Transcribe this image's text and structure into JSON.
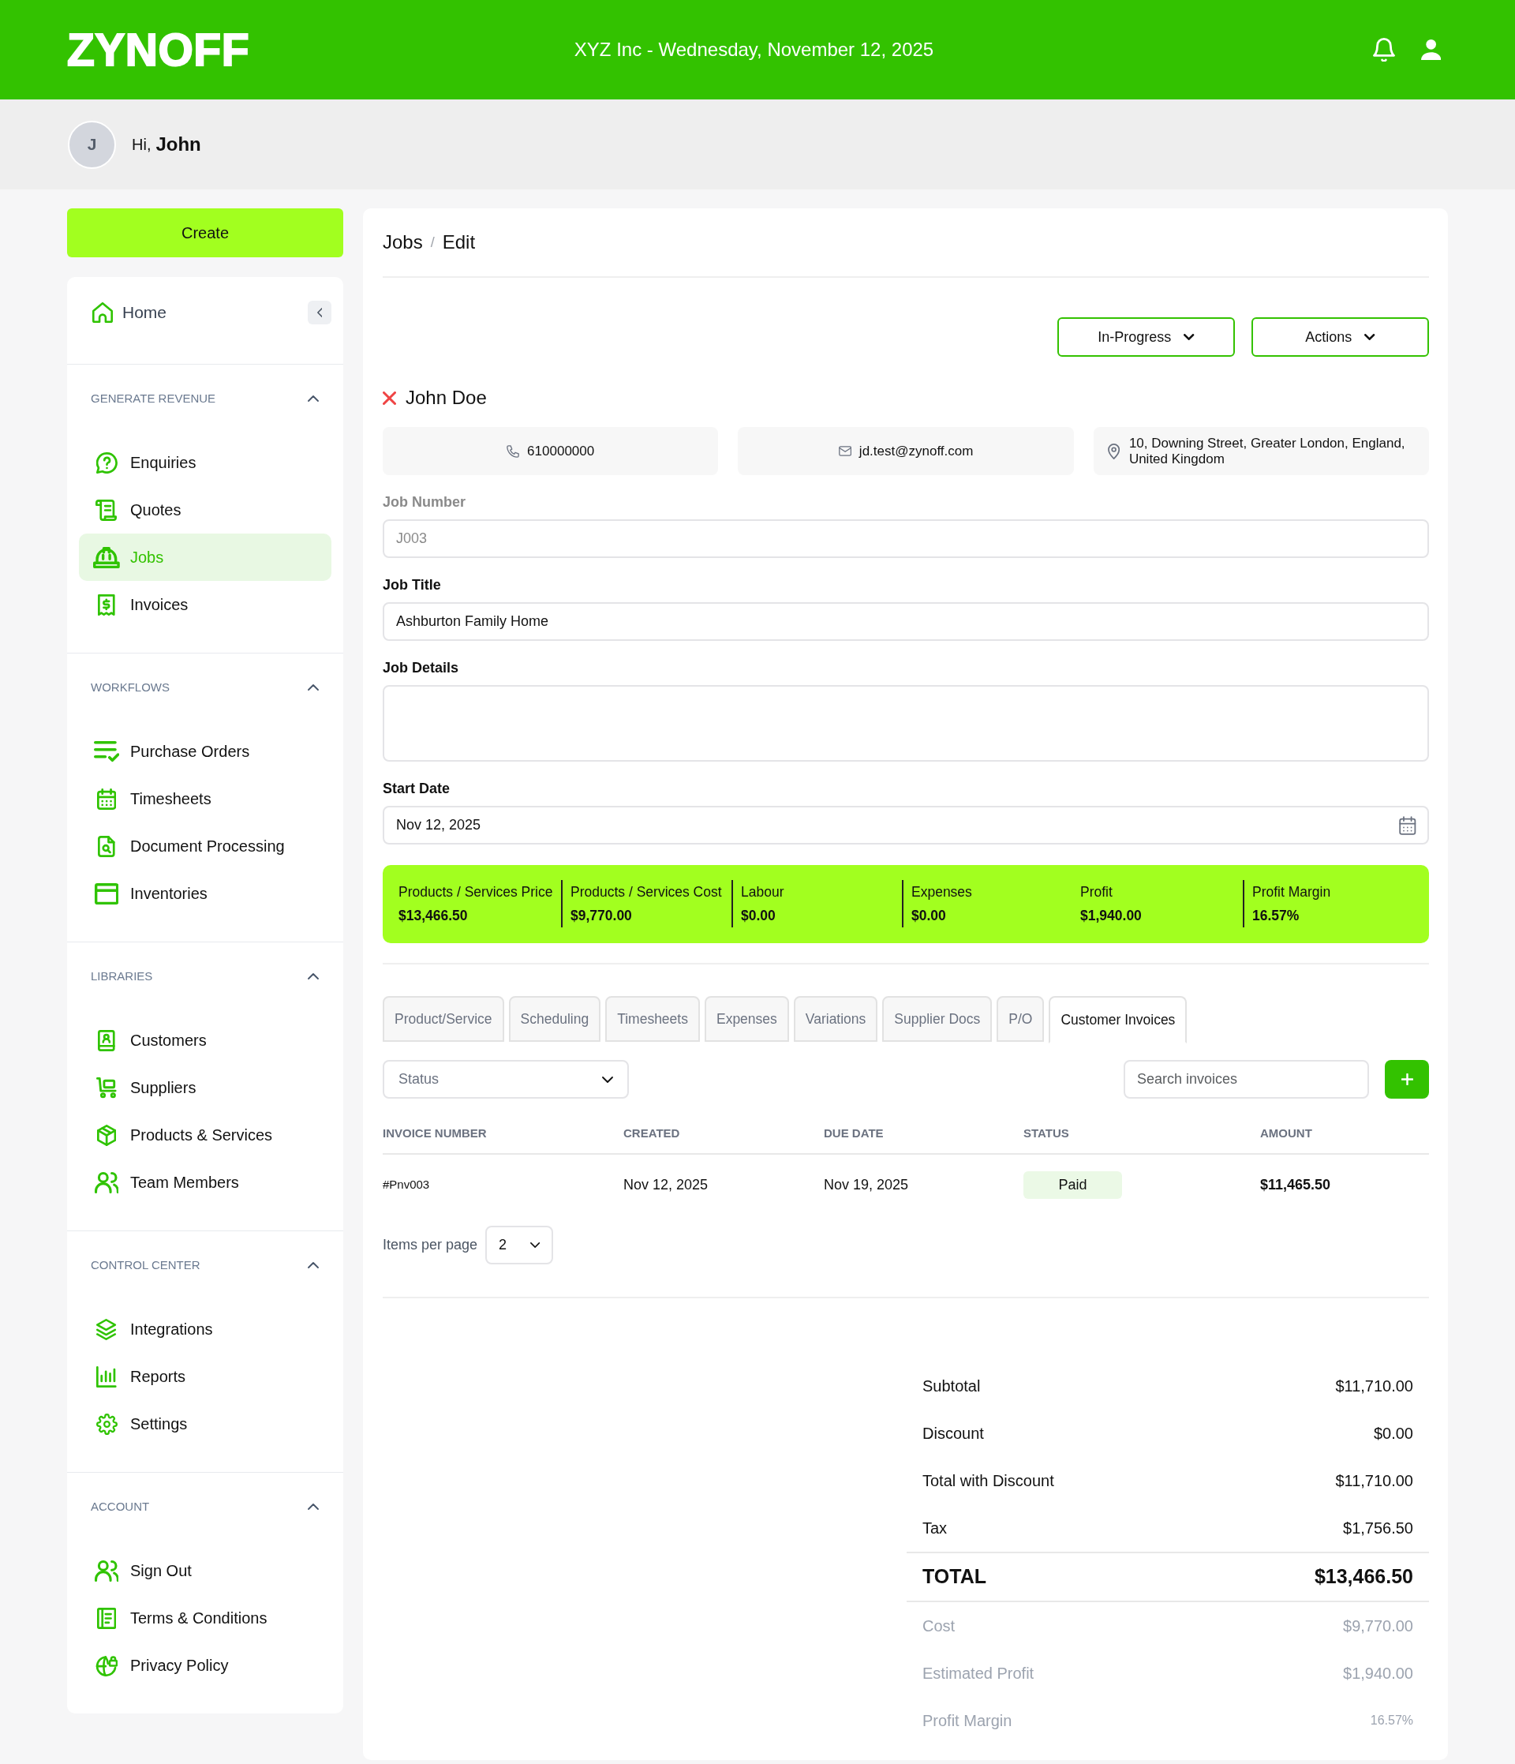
{
  "header": {
    "logo": "ZYNOFF",
    "title": "XYZ Inc - Wednesday, November 12, 2025"
  },
  "greeting": {
    "avatar_initial": "J",
    "salutation": "Hi,",
    "name": "John"
  },
  "sidebar": {
    "create_button": "Create",
    "home": {
      "label": "Home",
      "selected": false
    },
    "sections": [
      {
        "title": "GENERATE REVENUE",
        "expanded": true,
        "items": [
          {
            "label": "Enquiries",
            "selected": false
          },
          {
            "label": "Quotes",
            "selected": false
          },
          {
            "label": "Jobs",
            "selected": true
          },
          {
            "label": "Invoices",
            "selected": false
          }
        ]
      },
      {
        "title": "WORKFLOWS",
        "expanded": true,
        "items": [
          {
            "label": "Purchase Orders",
            "selected": false
          },
          {
            "label": "Timesheets",
            "selected": false
          },
          {
            "label": "Document Processing",
            "selected": false
          },
          {
            "label": "Inventories",
            "selected": false
          }
        ]
      },
      {
        "title": "LIBRARIES",
        "expanded": true,
        "items": [
          {
            "label": "Customers",
            "selected": false
          },
          {
            "label": "Suppliers",
            "selected": false
          },
          {
            "label": "Products & Services",
            "selected": false
          },
          {
            "label": "Team Members",
            "selected": false
          }
        ]
      },
      {
        "title": "CONTROL CENTER",
        "expanded": true,
        "items": [
          {
            "label": "Integrations",
            "selected": false
          },
          {
            "label": "Reports",
            "selected": false
          },
          {
            "label": "Settings",
            "selected": false
          }
        ]
      },
      {
        "title": "ACCOUNT",
        "expanded": true,
        "items": [
          {
            "label": "Sign Out",
            "selected": false
          },
          {
            "label": "Terms & Conditions",
            "selected": false
          },
          {
            "label": "Privacy Policy",
            "selected": false
          }
        ]
      }
    ]
  },
  "breadcrumb": {
    "items": [
      "Jobs",
      "Edit"
    ],
    "separator": "/"
  },
  "status_button": "In-Progress",
  "actions_button": "Actions",
  "customer": {
    "name": "John Doe",
    "phone": "610000000",
    "email": "jd.test@zynoff.com",
    "address": "10, Downing Street, Greater London, England, United Kingdom"
  },
  "fields": [
    {
      "label": "Job Number",
      "value": "J003",
      "kind": "text",
      "disabled": true
    },
    {
      "label": "Job Title",
      "value": "Ashburton Family Home",
      "kind": "text",
      "disabled": false
    },
    {
      "label": "Job Details",
      "kind": "textarea",
      "disabled": false
    },
    {
      "label": "Start Date",
      "value": "Nov 12, 2025",
      "kind": "date",
      "disabled": false
    }
  ],
  "summary": [
    {
      "label": "Products / Services Price",
      "value": "$13,466.50",
      "separated": false
    },
    {
      "label": "Products / Services Cost",
      "value": "$9,770.00",
      "separated": true
    },
    {
      "label": "Labour",
      "value": "$0.00",
      "separated": true
    },
    {
      "label": "Expenses",
      "value": "$0.00",
      "separated": true
    },
    {
      "label": "Profit",
      "value": "$1,940.00",
      "separated": false
    },
    {
      "label": "Profit Margin",
      "value": "16.57%",
      "separated": true
    }
  ],
  "tabs": [
    {
      "label": "Product/Service",
      "selected": false
    },
    {
      "label": "Scheduling",
      "selected": false
    },
    {
      "label": "Timesheets",
      "selected": false
    },
    {
      "label": "Expenses",
      "selected": false
    },
    {
      "label": "Variations",
      "selected": false
    },
    {
      "label": "Supplier Docs",
      "selected": false
    },
    {
      "label": "P/O",
      "selected": false
    },
    {
      "label": "Customer Invoices",
      "selected": true
    }
  ],
  "invoices": {
    "status_filter": {
      "placeholder": "Status"
    },
    "search": {
      "placeholder": "Search invoices"
    },
    "columns": [
      "INVOICE NUMBER",
      "CREATED",
      "DUE DATE",
      "STATUS",
      "AMOUNT"
    ],
    "rows": [
      {
        "invoice_number": "#Pnv003",
        "created": "Nov 12, 2025",
        "due_date": "Nov 19, 2025",
        "status": "Paid",
        "amount": "$11,465.50"
      }
    ],
    "pagination": {
      "label": "Items per page",
      "value": "2"
    }
  },
  "totals": [
    {
      "label": "Subtotal",
      "value": "$11,710.00",
      "kind": "line"
    },
    {
      "label": "Discount",
      "value": "$0.00",
      "kind": "line"
    },
    {
      "label": "Total with Discount",
      "value": "$11,710.00",
      "kind": "line"
    },
    {
      "label": "Tax",
      "value": "$1,756.50",
      "kind": "line"
    },
    {
      "label": "TOTAL",
      "value": "$13,466.50",
      "kind": "total"
    },
    {
      "label": "Cost",
      "value": "$9,770.00",
      "kind": "muted"
    },
    {
      "label": "Estimated Profit",
      "value": "$1,940.00",
      "kind": "muted"
    },
    {
      "label": "Profit Margin",
      "value": "16.57%",
      "kind": "percent"
    }
  ]
}
